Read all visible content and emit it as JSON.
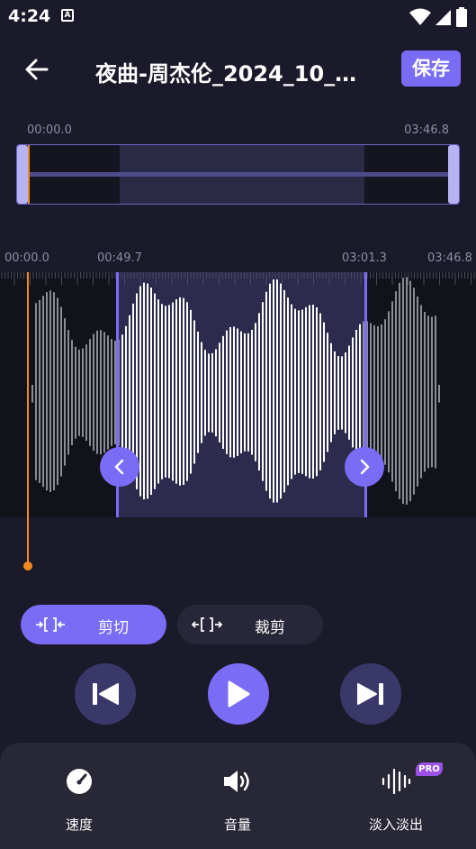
{
  "status_bar": {
    "time": "4:24",
    "notification_letter": "A"
  },
  "app_bar": {
    "title": "夜曲-周杰伦_2024_10_…",
    "save_label": "保存"
  },
  "overview": {
    "start_time": "00:00.0",
    "end_time": "03:46.8"
  },
  "timeline": {
    "labels": [
      "00:00.0",
      "00:49.7",
      "03:01.3",
      "03:46.8"
    ],
    "selection_start": "00:49.7",
    "selection_end": "03:01.3"
  },
  "modes": {
    "cut_label": "剪切",
    "trim_label": "裁剪",
    "active": "cut"
  },
  "playback": {
    "prev_icon": "skip-previous-icon",
    "play_icon": "play-icon",
    "next_icon": "skip-next-icon"
  },
  "tools": [
    {
      "label": "速度",
      "icon": "speedometer-icon"
    },
    {
      "label": "音量",
      "icon": "volume-icon"
    },
    {
      "label": "淡入淡出",
      "icon": "waveform-icon",
      "badge": "PRO"
    }
  ],
  "colors": {
    "accent": "#7b6cf6",
    "playhead": "#f08a1e",
    "background": "#1a1a2a"
  }
}
